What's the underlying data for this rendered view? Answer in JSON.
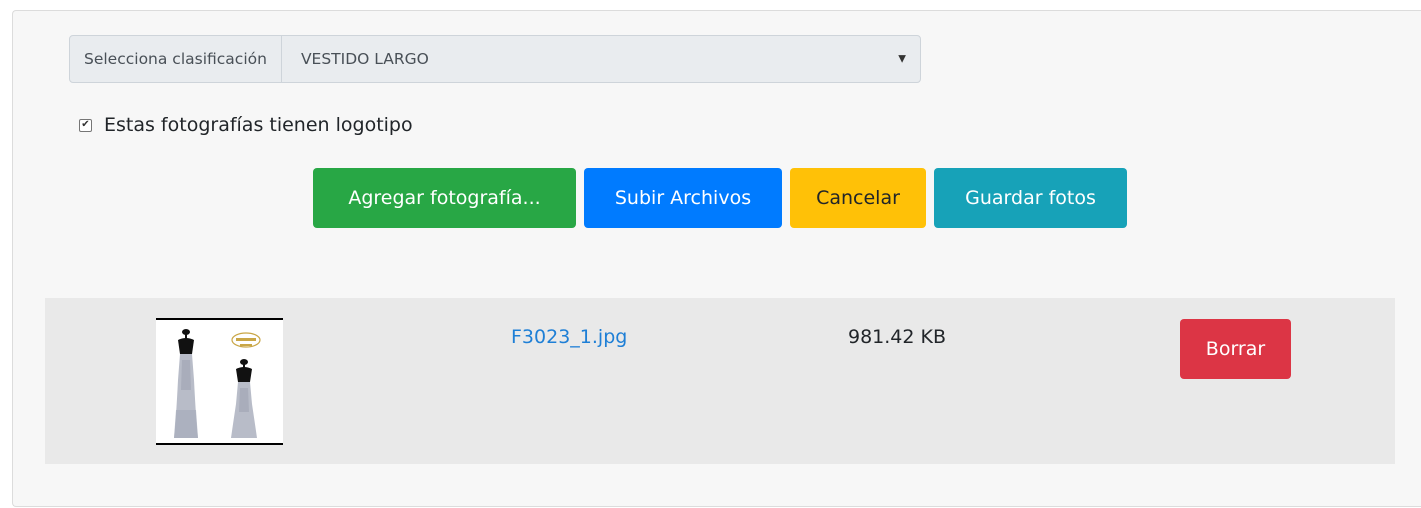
{
  "classification": {
    "label": "Selecciona clasificación",
    "selected": "VESTIDO LARGO"
  },
  "logo_checkbox": {
    "label": "Estas fotografías tienen logotipo",
    "checked": true
  },
  "buttons": {
    "add": "Agregar fotografía...",
    "upload": "Subir Archivos",
    "cancel": "Cancelar",
    "save": "Guardar fotos"
  },
  "files": [
    {
      "name": "F3023_1.jpg",
      "size": "981.42 KB",
      "delete_label": "Borrar"
    }
  ],
  "colors": {
    "add": "#28a745",
    "upload": "#007bff",
    "cancel": "#ffc107",
    "save": "#17a2b8",
    "delete": "#dc3545",
    "link": "#1e7fd6"
  },
  "icons": {
    "select_arrow": "chevron-down-icon",
    "checkbox": "check-icon"
  }
}
